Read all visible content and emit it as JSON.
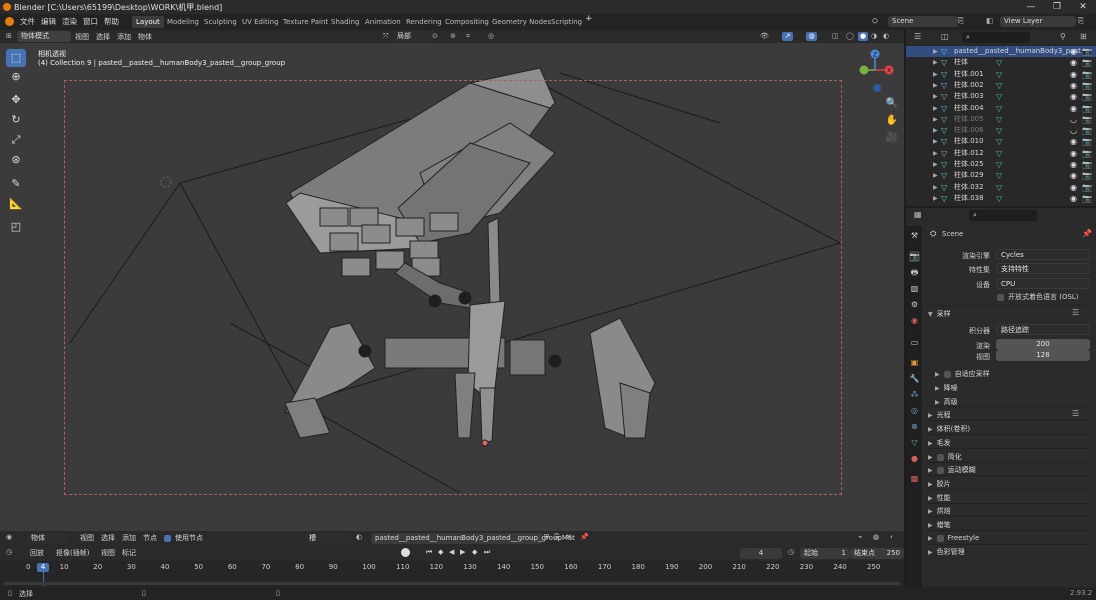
{
  "window": {
    "title": "Blender [C:\\Users\\65199\\Desktop\\WORK\\机甲.blend]",
    "controls": [
      "—",
      "❐",
      "✕"
    ]
  },
  "menu": [
    "文件",
    "编辑",
    "渲染",
    "窗口",
    "帮助"
  ],
  "workspaces": [
    "Layout",
    "Modeling",
    "Sculpting",
    "UV Editing",
    "Texture Paint",
    "Shading",
    "Animation",
    "Rendering",
    "Compositing",
    "Geometry Nodes",
    "Scripting"
  ],
  "active_workspace": "Layout",
  "scene": {
    "name": "Scene",
    "view_layer": "View Layer"
  },
  "viewport_header": {
    "mode": "物体模式",
    "items": [
      "视图",
      "选择",
      "添加",
      "物体"
    ],
    "orientation": "局部"
  },
  "viewport": {
    "camera_title": "相机透视",
    "collection_line": "(4) Collection 9 | pasted__pasted__humanBody3_pasted__group_group"
  },
  "outliner": {
    "search_placeholder": "",
    "rows": [
      {
        "name": "pasted__pasted__humanBody3_past",
        "state": "selected"
      },
      {
        "name": "柱体",
        "state": "normal"
      },
      {
        "name": "柱体.001",
        "state": "normal"
      },
      {
        "name": "柱体.002",
        "state": "normal"
      },
      {
        "name": "柱体.003",
        "state": "normal"
      },
      {
        "name": "柱体.004",
        "state": "normal"
      },
      {
        "name": "柱体.005",
        "state": "hidden"
      },
      {
        "name": "柱体.006",
        "state": "hidden"
      },
      {
        "name": "柱体.010",
        "state": "normal"
      },
      {
        "name": "柱体.012",
        "state": "normal"
      },
      {
        "name": "柱体.025",
        "state": "normal"
      },
      {
        "name": "柱体.029",
        "state": "normal"
      },
      {
        "name": "柱体.032",
        "state": "normal"
      },
      {
        "name": "柱体.038",
        "state": "normal"
      }
    ]
  },
  "properties": {
    "scene_label": "Scene",
    "render_engine_label": "渲染引擎",
    "render_engine": "Cycles",
    "feature_set_label": "特性集",
    "feature_set": "支持特性",
    "device_label": "设备",
    "device": "CPU",
    "osl_label": "开放式着色语言 (OSL)",
    "sampling": "采样",
    "integrator_label": "积分器",
    "integrator": "路径追踪",
    "render_label": "渲染",
    "render_samples": "200",
    "viewport_label": "视图",
    "viewport_samples": "128",
    "sub_sections": [
      "自适应采样",
      "降噪",
      "高级"
    ],
    "sections": [
      "光程",
      "体积(卷积)",
      "毛发",
      "简化",
      "运动模糊",
      "胶片",
      "性能",
      "烘焙",
      "蜡笔",
      "Freestyle",
      "色彩管理"
    ]
  },
  "shader_header": {
    "editor": "物体",
    "items": [
      "视图",
      "选择",
      "添加",
      "节点"
    ],
    "use_nodes": "使用节点",
    "slot": "槽",
    "material": "pasted__pasted__humanBody3_pasted__group_groupMat"
  },
  "timeline": {
    "playback": "回放",
    "keying": "抠像(插帧)",
    "items": [
      "视图",
      "标记"
    ],
    "current_frame": "4",
    "start_label": "起始",
    "start": "1",
    "end_label": "结束点",
    "end": "250",
    "ticks": [
      "0",
      "10",
      "20",
      "30",
      "40",
      "50",
      "60",
      "70",
      "80",
      "90",
      "100",
      "110",
      "120",
      "130",
      "140",
      "150",
      "160",
      "170",
      "180",
      "190",
      "200",
      "210",
      "220",
      "230",
      "240",
      "250"
    ],
    "playhead": "4"
  },
  "status": {
    "select": "选择",
    "version": "2.93.2"
  },
  "colors": {
    "accent": "#4772b3",
    "selection": "#334d80",
    "camera_frame": "#b0605a",
    "logo": "#e87d0d"
  }
}
